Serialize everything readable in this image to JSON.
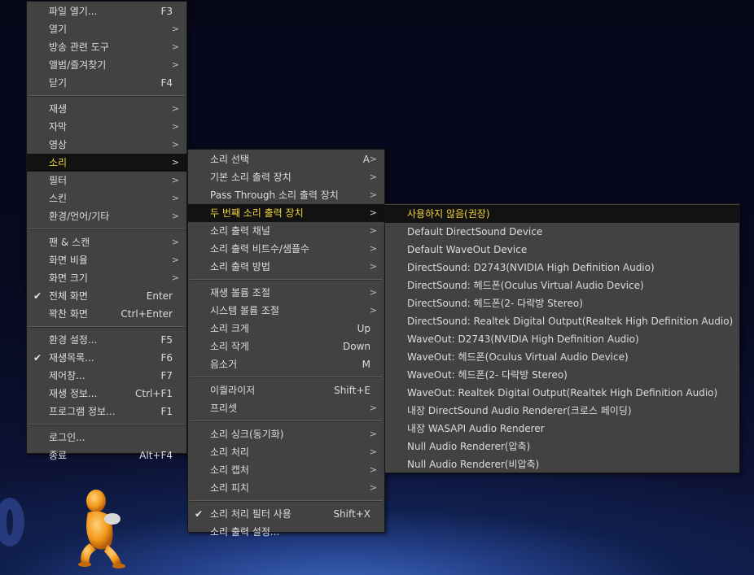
{
  "main_menu": {
    "groups": [
      [
        {
          "label": "파일 열기...",
          "shortcut": "F3",
          "submenu": false
        },
        {
          "label": "열기",
          "shortcut": "",
          "submenu": true
        },
        {
          "label": "방송 관련 도구",
          "shortcut": "",
          "submenu": true
        },
        {
          "label": "앨범/즐겨찾기",
          "shortcut": "",
          "submenu": true
        },
        {
          "label": "닫기",
          "shortcut": "F4",
          "submenu": false
        }
      ],
      [
        {
          "label": "재생",
          "shortcut": "",
          "submenu": true
        },
        {
          "label": "자막",
          "shortcut": "",
          "submenu": true
        },
        {
          "label": "영상",
          "shortcut": "",
          "submenu": true
        },
        {
          "label": "소리",
          "shortcut": "",
          "submenu": true,
          "highlighted": true
        },
        {
          "label": "필터",
          "shortcut": "",
          "submenu": true
        },
        {
          "label": "스킨",
          "shortcut": "",
          "submenu": true
        },
        {
          "label": "환경/언어/기타",
          "shortcut": "",
          "submenu": true
        }
      ],
      [
        {
          "label": "팬 & 스캔",
          "shortcut": "",
          "submenu": true
        },
        {
          "label": "화면 비율",
          "shortcut": "",
          "submenu": true
        },
        {
          "label": "화면 크기",
          "shortcut": "",
          "submenu": true
        },
        {
          "label": "전체 화면",
          "shortcut": "Enter",
          "submenu": false,
          "checked": true
        },
        {
          "label": "꽉찬 화면",
          "shortcut": "Ctrl+Enter",
          "submenu": false
        }
      ],
      [
        {
          "label": "환경 설정...",
          "shortcut": "F5",
          "submenu": false
        },
        {
          "label": "재생목록...",
          "shortcut": "F6",
          "submenu": false,
          "checked": true
        },
        {
          "label": "제어창...",
          "shortcut": "F7",
          "submenu": false
        },
        {
          "label": "재생 정보...",
          "shortcut": "Ctrl+F1",
          "submenu": false
        },
        {
          "label": "프로그램 정보...",
          "shortcut": "F1",
          "submenu": false
        }
      ],
      [
        {
          "label": "로그인...",
          "shortcut": "",
          "submenu": false
        },
        {
          "label": "종료",
          "shortcut": "Alt+F4",
          "submenu": false
        }
      ]
    ]
  },
  "sound_menu": {
    "groups": [
      [
        {
          "label": "소리 선택",
          "shortcut": "A",
          "submenu": true
        },
        {
          "label": "기본 소리 출력 장치",
          "shortcut": "",
          "submenu": true
        },
        {
          "label": "Pass Through 소리 출력 장치",
          "shortcut": "",
          "submenu": true
        },
        {
          "label": "두 번째 소리 출력 장치",
          "shortcut": "",
          "submenu": true,
          "highlighted": true
        },
        {
          "label": "소리 출력 채널",
          "shortcut": "",
          "submenu": true
        },
        {
          "label": "소리 출력 비트수/샘플수",
          "shortcut": "",
          "submenu": true
        },
        {
          "label": "소리 출력 방법",
          "shortcut": "",
          "submenu": true
        }
      ],
      [
        {
          "label": "재생 볼륨 조절",
          "shortcut": "",
          "submenu": true
        },
        {
          "label": "시스템 볼륨 조절",
          "shortcut": "",
          "submenu": true
        },
        {
          "label": "소리 크게",
          "shortcut": "Up",
          "submenu": false
        },
        {
          "label": "소리 작게",
          "shortcut": "Down",
          "submenu": false
        },
        {
          "label": "음소거",
          "shortcut": "M",
          "submenu": false
        }
      ],
      [
        {
          "label": "이퀄라이저",
          "shortcut": "Shift+E",
          "submenu": false
        },
        {
          "label": "프리셋",
          "shortcut": "",
          "submenu": true
        }
      ],
      [
        {
          "label": "소리 싱크(동기화)",
          "shortcut": "",
          "submenu": true
        },
        {
          "label": "소리 처리",
          "shortcut": "",
          "submenu": true
        },
        {
          "label": "소리 캡처",
          "shortcut": "",
          "submenu": true
        },
        {
          "label": "소리 피치",
          "shortcut": "",
          "submenu": true
        }
      ],
      [
        {
          "label": "소리 처리 필터 사용",
          "shortcut": "Shift+X",
          "submenu": false,
          "checked": true
        },
        {
          "label": "소리 출력 설정...",
          "shortcut": "",
          "submenu": false
        }
      ]
    ]
  },
  "device_menu": {
    "groups": [
      [
        {
          "label": "사용하지 않음(권장)",
          "highlighted": true
        },
        {
          "label": "Default DirectSound Device"
        },
        {
          "label": "Default WaveOut Device"
        },
        {
          "label": "DirectSound: D2743(NVIDIA High Definition Audio)"
        },
        {
          "label": "DirectSound: 헤드폰(Oculus Virtual Audio Device)"
        },
        {
          "label": "DirectSound: 헤드폰(2- 다락방 Stereo)"
        },
        {
          "label": "DirectSound: Realtek Digital Output(Realtek High Definition Audio)"
        },
        {
          "label": "WaveOut: D2743(NVIDIA High Definition Audio)"
        },
        {
          "label": "WaveOut: 헤드폰(Oculus Virtual Audio Device)"
        },
        {
          "label": "WaveOut: 헤드폰(2- 다락방 Stereo)"
        },
        {
          "label": "WaveOut: Realtek Digital Output(Realtek High Definition Audio)"
        },
        {
          "label": "내장 DirectSound Audio Renderer(크로스 페이딩)"
        },
        {
          "label": "내장 WASAPI Audio Renderer"
        },
        {
          "label": "Null Audio Renderer(압축)"
        },
        {
          "label": "Null Audio Renderer(비압축)"
        }
      ]
    ]
  },
  "colors": {
    "menu_bg": "#424242",
    "highlight_bg": "#121212",
    "highlight_text": "#f2d33a",
    "text": "#dcdcdc"
  },
  "icons": {
    "check": "check-icon",
    "submenu": "chevron-right-icon"
  }
}
